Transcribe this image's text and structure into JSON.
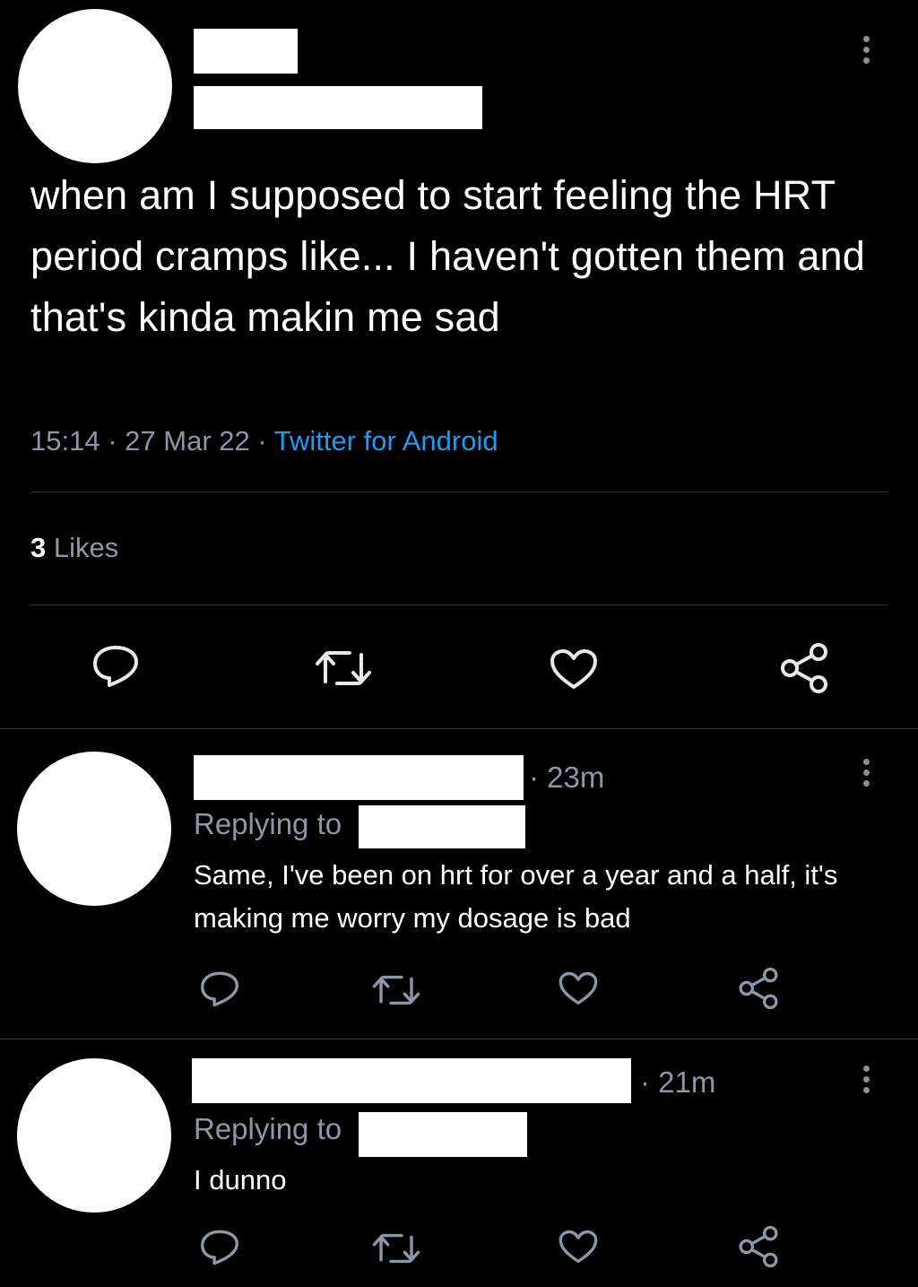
{
  "tweet": {
    "text": "when am I supposed to start feeling the HRT period cramps like... I haven't gotten them and that's kinda makin me sad",
    "time": "15:14",
    "date": "27 Mar 22",
    "source": "Twitter for Android",
    "likes_count": "3",
    "likes_label": "Likes",
    "separator": "·"
  },
  "replies": [
    {
      "time": "· 23m",
      "replying_to_label": "Replying to",
      "text": "Same, I've been on hrt for over a year and a half, it's making me worry my dosage is bad"
    },
    {
      "time": "· 21m",
      "replying_to_label": "Replying to",
      "text": "I dunno"
    }
  ],
  "icons": {
    "reply": "reply-icon",
    "retweet": "retweet-icon",
    "like": "heart-icon",
    "share": "share-icon",
    "more": "more-options-icon"
  },
  "colors": {
    "background": "#000000",
    "text": "#ffffff",
    "secondary": "#8b98a5",
    "link": "#1d9bf0",
    "divider": "#2f3336"
  }
}
